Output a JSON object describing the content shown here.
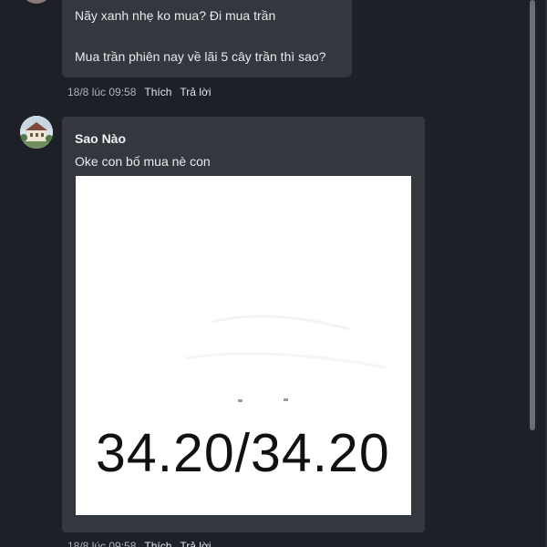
{
  "comments": [
    {
      "lines": [
        "Nãy xanh nhẹ ko mua? Đi mua trần",
        "Mua trần phiên nay về lãi 5 cây trần thì sao?"
      ],
      "time": "18/8 lúc 09:58",
      "like_label": "Thích",
      "reply_label": "Trả lời"
    },
    {
      "author": "Sao Nào",
      "text": "Oke con bố mua nè con",
      "image_text": "34.20/34.20",
      "time": "18/8 lúc 09:58",
      "like_label": "Thích",
      "reply_label": "Trả lời"
    }
  ],
  "colors": {
    "background": "#1d2127",
    "bubble": "#33383f",
    "text": "#e9eaec",
    "meta": "#b0b3b8"
  }
}
